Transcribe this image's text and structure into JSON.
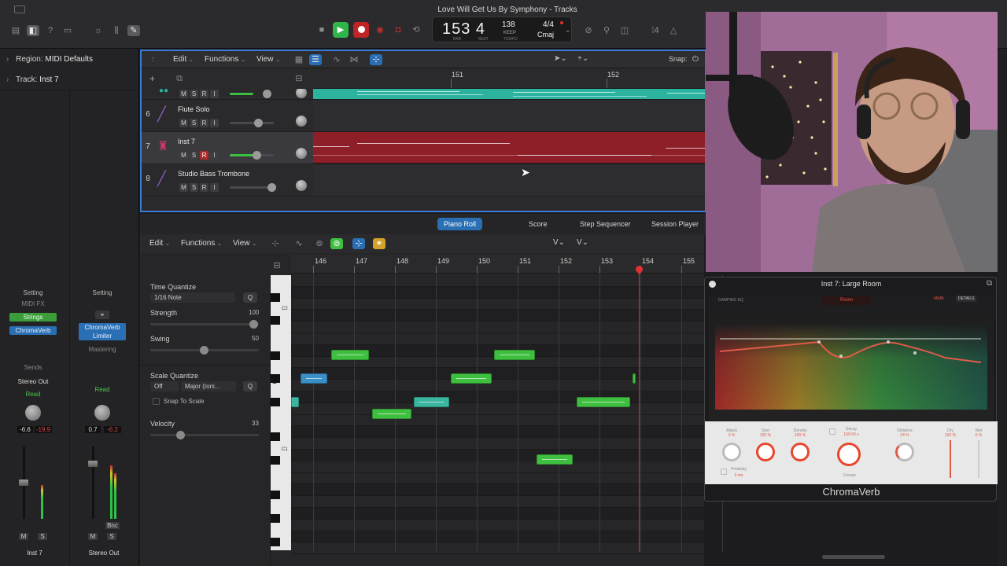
{
  "window": {
    "title": "Love Will Get Us By Symphony - Tracks"
  },
  "lcd": {
    "position": "153  4",
    "bar_label": "BAR",
    "beat_label": "BEAT",
    "tempo": "138",
    "tempo_sub": "KEEP",
    "tempo_label": "TEMPO",
    "time_sig": "4/4",
    "key": "Cmaj"
  },
  "inspector": {
    "region_label": "Region:",
    "region_value": "MIDI Defaults",
    "track_label": "Track:",
    "track_value": "Inst 7",
    "strip1": {
      "setting": "Setting",
      "midi_fx": "MIDI FX",
      "instrument": "Strings",
      "insert": "ChromaVerb",
      "sends": "Sends",
      "output": "Stereo Out",
      "automation": "Read",
      "vol": "-6.6",
      "peak": "-19.9",
      "mute": "M",
      "solo": "S",
      "name": "Inst 7"
    },
    "strip2": {
      "setting": "Setting",
      "insert1": "ChromaVerb",
      "insert2": "Limiter",
      "mastering": "Mastering",
      "automation": "Read",
      "vol": "0.7",
      "peak": "-6.2",
      "bnc": "Bnc",
      "mute": "M",
      "solo": "S",
      "name": "Stereo Out"
    }
  },
  "tracks_toolbar": {
    "edit": "Edit",
    "functions": "Functions",
    "view": "View",
    "snap_label": "Snap:"
  },
  "ruler": {
    "bar151": "151",
    "bar152": "152"
  },
  "tracks": [
    {
      "num": "6",
      "name": "Flute Solo",
      "m": "M",
      "s": "S",
      "r": "R",
      "i": "I"
    },
    {
      "num": "7",
      "name": "Inst 7",
      "m": "M",
      "s": "S",
      "r": "R",
      "i": "I"
    },
    {
      "num": "8",
      "name": "Studio Bass Trombone",
      "m": "M",
      "s": "S",
      "r": "R",
      "i": "I"
    }
  ],
  "editor_tabs": {
    "piano_roll": "Piano Roll",
    "score": "Score",
    "step_sequencer": "Step Sequencer",
    "session_player": "Session Player"
  },
  "piano_roll": {
    "edit": "Edit",
    "functions": "Functions",
    "view": "View",
    "bars": [
      "146",
      "147",
      "148",
      "149",
      "150",
      "151",
      "152",
      "153",
      "154",
      "155"
    ],
    "time_quantize": "Time Quantize",
    "tq_value": "1/16 Note",
    "q": "Q",
    "strength": "Strength",
    "strength_val": "100",
    "swing": "Swing",
    "swing_val": "50",
    "scale_quantize": "Scale Quantize",
    "sq_off": "Off",
    "sq_scale": "Major (Ioni...",
    "snap_to_scale": "Snap To Scale",
    "velocity": "Velocity",
    "velocity_val": "33",
    "c2": "C2",
    "c1": "C1"
  },
  "chromaverb": {
    "title": "Inst 7: Large Room",
    "damping_eq": "DAMPING EQ",
    "room": "Room",
    "main_tab": "MAIN",
    "details_tab": "DETAILS",
    "attack": "Attack",
    "attack_val": "0 %",
    "size": "Size",
    "size_val": "100 %",
    "density": "Density",
    "density_val": "100 %",
    "decay": "Decay",
    "decay_val": "100.00 s",
    "distance": "Distance",
    "distance_val": "24 %",
    "dry": "Dry",
    "dry_val": "100 %",
    "wet": "Wet",
    "wet_val": "0 %",
    "predelay": "Predelay",
    "predelay_val": "0 ms",
    "freeze": "Freeze",
    "name": "ChromaVerb"
  },
  "colors": {
    "accent_blue": "#2a6fb3",
    "note_green": "#3fbf3f",
    "region_teal": "#2bb3a0",
    "region_red": "#8e1f28",
    "playhead": "#e03030"
  }
}
